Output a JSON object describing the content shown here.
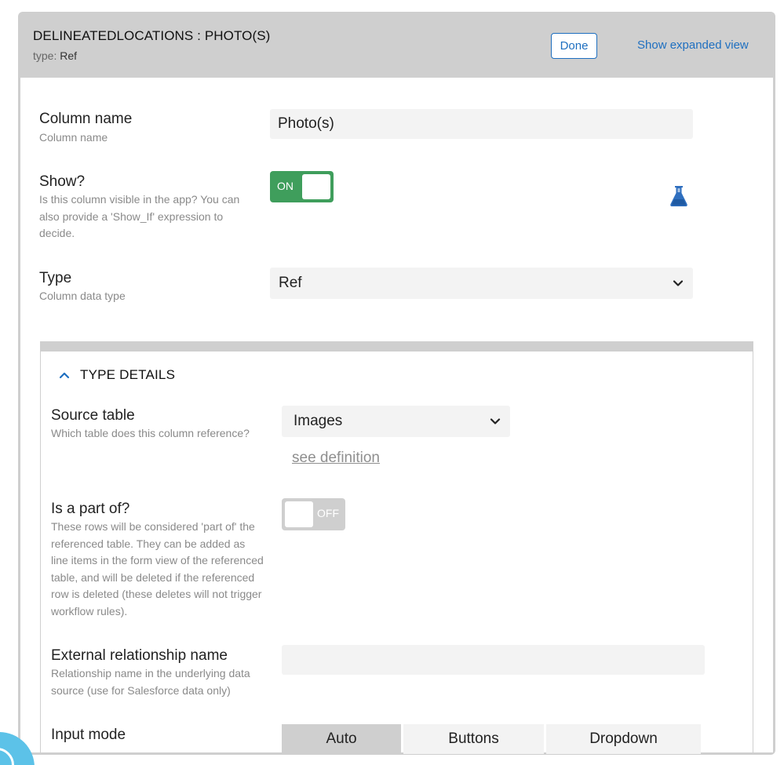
{
  "header": {
    "title": "DELINEATEDLOCATIONS : PHOTO(S)",
    "type_prefix": "type:",
    "type_value": "Ref",
    "done_label": "Done",
    "expand_label": "Show expanded view"
  },
  "column_name": {
    "label": "Column name",
    "description": "Column name",
    "value": "Photo(s)"
  },
  "show": {
    "label": "Show?",
    "description": "Is this column visible in the app? You can also provide a 'Show_If' expression to decide.",
    "toggle_label": "ON",
    "toggle_state": true
  },
  "type": {
    "label": "Type",
    "description": "Column data type",
    "selected": "Ref"
  },
  "type_details": {
    "heading": "TYPE DETAILS",
    "source_table": {
      "label": "Source table",
      "description": "Which table does this column reference?",
      "selected": "Images",
      "link": "see definition"
    },
    "is_part_of": {
      "label": "Is a part of?",
      "description": "These rows will be considered 'part of' the referenced table. They can be added as line items in the form view of the referenced table, and will be deleted if the referenced row is deleted (these deletes will not trigger workflow rules).",
      "toggle_label": "OFF",
      "toggle_state": false
    },
    "external_relationship": {
      "label": "External relationship name",
      "description": "Relationship name in the underlying data source (use for Salesforce data only)",
      "value": ""
    },
    "input_mode": {
      "label": "Input mode",
      "options": [
        "Auto",
        "Buttons",
        "Dropdown"
      ],
      "selected": "Auto"
    }
  },
  "colors": {
    "accent": "#1e6fc0",
    "toggle_on": "#3f9e5c",
    "toggle_off": "#cfcfcf",
    "flask": "#2f6fbf",
    "fab": "#5cc2e8"
  },
  "icons": [
    "flask-icon",
    "chevron-down-icon",
    "chevron-up-icon"
  ]
}
